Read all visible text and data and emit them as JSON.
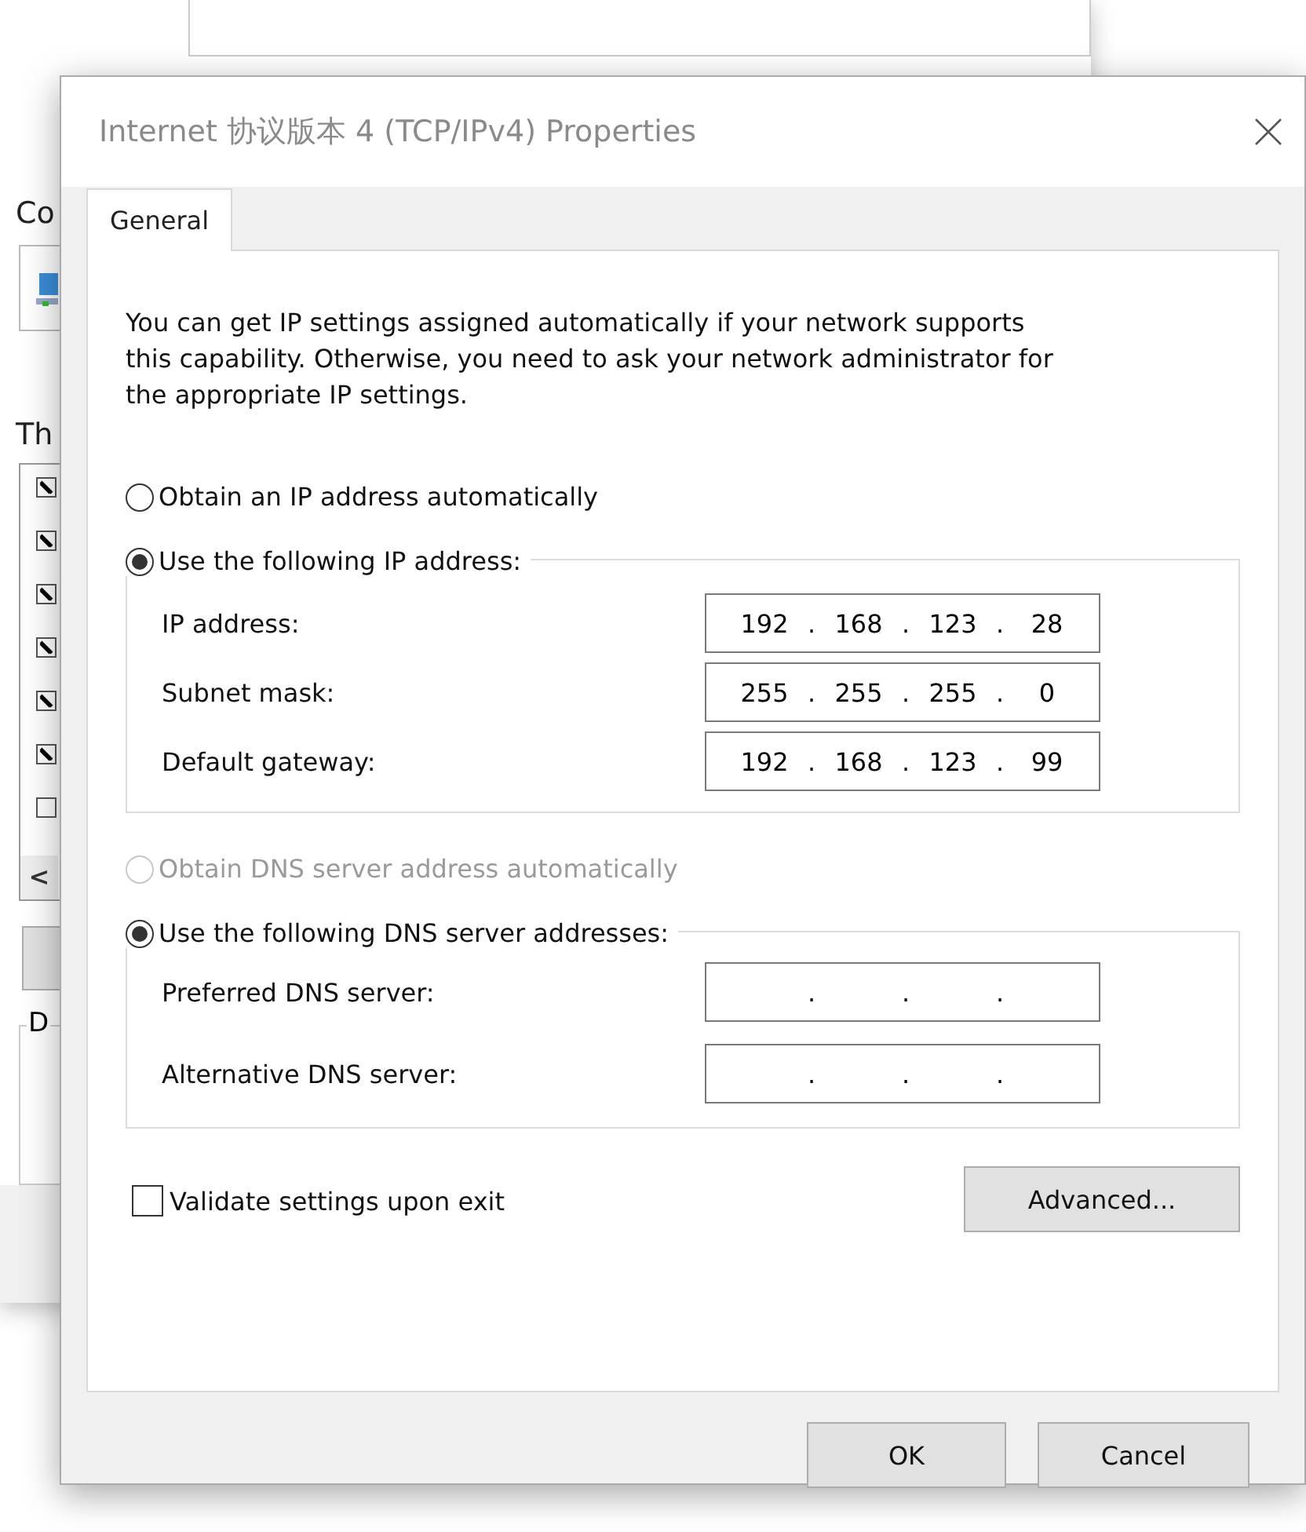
{
  "background_window": {
    "label_top": "Co",
    "label_list": "Th",
    "list_items": [
      {
        "checked": true
      },
      {
        "checked": true
      },
      {
        "checked": true
      },
      {
        "checked": true
      },
      {
        "checked": true
      },
      {
        "checked": true
      },
      {
        "checked": false
      }
    ],
    "scroll_arrow": "<",
    "group_label": "D"
  },
  "dialog": {
    "title": "Internet 协议版本 4 (TCP/IPv4) Properties",
    "tabs": [
      {
        "label": "General",
        "selected": true
      }
    ],
    "description": "You can get IP settings assigned automatically if your network supports this capability. Otherwise, you need to ask your network administrator for the appropriate IP settings.",
    "ip_options": [
      {
        "label": "Obtain an IP address automatically",
        "selected": false,
        "disabled": false
      },
      {
        "label": "Use the following IP address:",
        "selected": true,
        "disabled": false
      }
    ],
    "ip_fields": [
      {
        "label": "IP address:",
        "octets": [
          "192",
          "168",
          "123",
          "28"
        ],
        "dots": [
          ".",
          ".",
          "."
        ]
      },
      {
        "label": "Subnet mask:",
        "octets": [
          "255",
          "255",
          "255",
          "0"
        ],
        "dots": [
          ".",
          ".",
          "."
        ]
      },
      {
        "label": "Default gateway:",
        "octets": [
          "192",
          "168",
          "123",
          "99"
        ],
        "dots": [
          ".",
          ".",
          "."
        ]
      }
    ],
    "dns_options": [
      {
        "label": "Obtain DNS server address automatically",
        "selected": false,
        "disabled": true
      },
      {
        "label": "Use the following DNS server addresses:",
        "selected": true,
        "disabled": false
      }
    ],
    "dns_fields": [
      {
        "label": "Preferred DNS server:",
        "dots": [
          ".",
          ".",
          "."
        ]
      },
      {
        "label": "Alternative DNS server:",
        "dots": [
          ".",
          ".",
          "."
        ]
      }
    ],
    "validate": {
      "label": "Validate settings upon exit",
      "checked": false
    },
    "advanced_button": "Advanced...",
    "buttons": [
      "OK",
      "Cancel"
    ]
  }
}
